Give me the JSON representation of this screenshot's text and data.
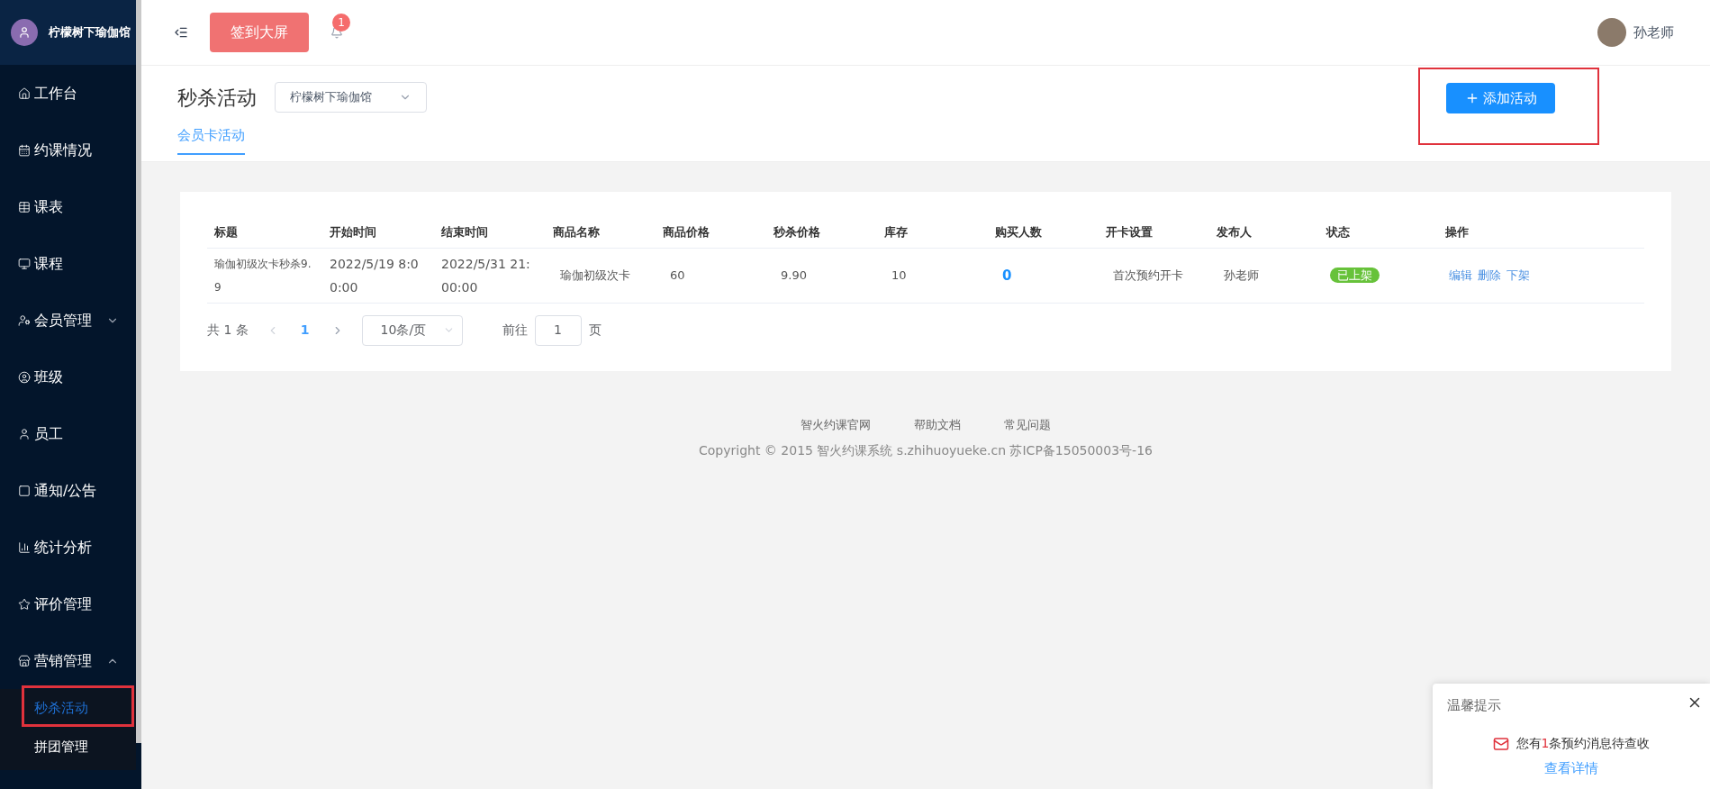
{
  "sidebar": {
    "brand": "柠檬树下瑜伽馆",
    "items": [
      {
        "label": "工作台",
        "selected": false
      },
      {
        "label": "约课情况",
        "selected": false
      },
      {
        "label": "课表",
        "selected": false
      },
      {
        "label": "课程",
        "selected": false
      },
      {
        "label": "会员管理",
        "selected": false,
        "expanded": false
      },
      {
        "label": "班级",
        "selected": false
      },
      {
        "label": "员工",
        "selected": false
      },
      {
        "label": "通知/公告",
        "selected": false
      },
      {
        "label": "统计分析",
        "selected": false
      },
      {
        "label": "评价管理",
        "selected": false
      },
      {
        "label": "营销管理",
        "selected": false,
        "expanded": true,
        "children": [
          {
            "label": "秒杀活动",
            "selected": true,
            "highlighted": true
          },
          {
            "label": "拼团管理",
            "selected": false,
            "highlighted": false
          }
        ]
      }
    ]
  },
  "header": {
    "signin_button": "签到大屏",
    "notification_badge": "1",
    "user_name": "孙老师"
  },
  "page": {
    "title": "秒杀活动",
    "store_select": "柠檬树下瑜伽馆",
    "add_button": {
      "label": "添加活动",
      "highlighted": true
    },
    "tabs": [
      {
        "label": "会员卡活动",
        "selected": true
      }
    ]
  },
  "table": {
    "columns": [
      "标题",
      "开始时间",
      "结束时间",
      "商品名称",
      "商品价格",
      "秒杀价格",
      "库存",
      "购买人数",
      "开卡设置",
      "发布人",
      "状态",
      "操作"
    ],
    "rows": [
      {
        "title": "瑜伽初级次卡秒杀9.9",
        "start": "2022/5/19 8:00:00",
        "end": "2022/5/31 21:00:00",
        "product": "瑜伽初级次卡",
        "price": "60",
        "flash_price": "9.90",
        "stock": "10",
        "buyers": "0",
        "card_setting": "首次预约开卡",
        "publisher": "孙老师",
        "status": "已上架",
        "actions": [
          "编辑",
          "删除",
          "下架"
        ]
      }
    ]
  },
  "pagination": {
    "total": "共 1 条",
    "pages": [
      {
        "label": "1",
        "selected": true
      }
    ],
    "page_size": "10条/页",
    "goto_label": "前往",
    "goto_value": "1",
    "goto_unit": "页"
  },
  "footer": {
    "links": [
      "智火约课官网",
      "帮助文档",
      "常见问题"
    ],
    "copyright": "Copyright © 2015 智火约课系统 s.zhihuoyueke.cn 苏ICP备15050003号-16"
  },
  "notice": {
    "title": "温馨提示",
    "message_before": "您有",
    "count": "1",
    "message_after": "条预约消息待查收",
    "link": "查看详情"
  }
}
